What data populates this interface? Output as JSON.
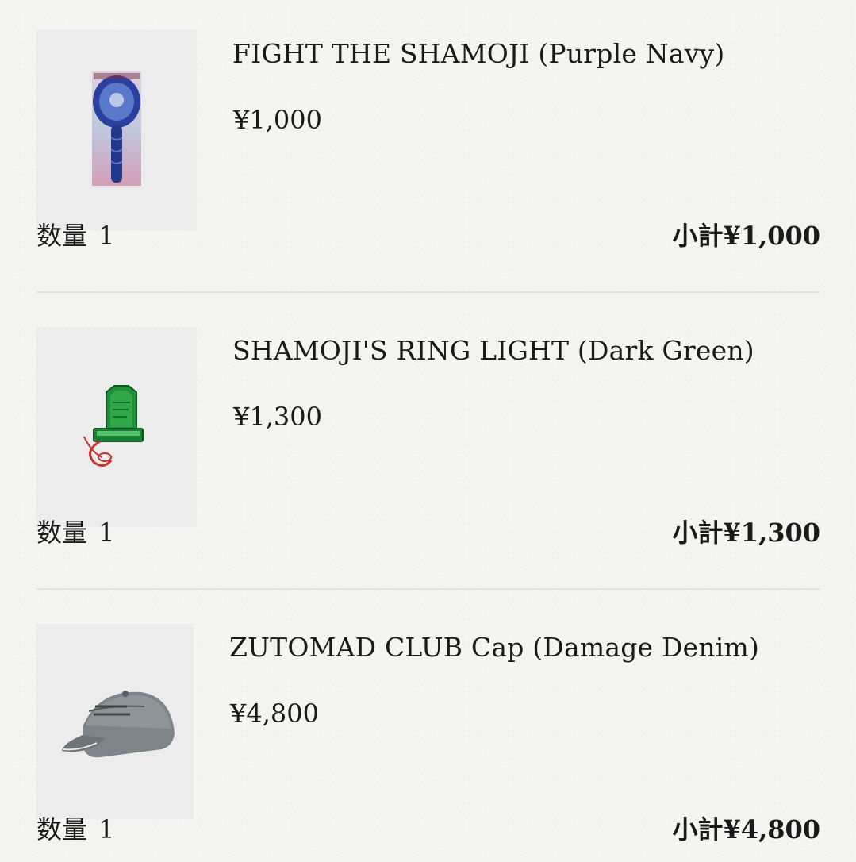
{
  "cart": {
    "quantity_label": "数量",
    "subtotal_label": "小計",
    "items": [
      {
        "name": "FIGHT THE SHAMOJI (Purple Navy)",
        "price": "¥1,000",
        "quantity": "1",
        "subtotal": "¥1,000",
        "image_icon": "shamoji-paddle-image"
      },
      {
        "name": "SHAMOJI'S RING LIGHT (Dark Green)",
        "price": "¥1,300",
        "quantity": "1",
        "subtotal": "¥1,300",
        "image_icon": "ring-light-image"
      },
      {
        "name": "ZUTOMAD CLUB Cap (Damage Denim)",
        "price": "¥4,800",
        "quantity": "1",
        "subtotal": "¥4,800",
        "image_icon": "cap-image"
      }
    ]
  },
  "colors": {
    "background": "#f4f4f3",
    "thumb_bg": "#ececec",
    "divider": "#e2e2e1",
    "text": "#1a1a1a"
  }
}
